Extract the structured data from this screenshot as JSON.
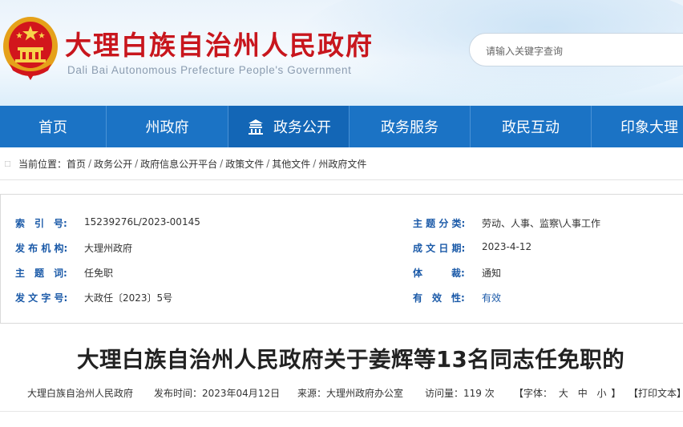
{
  "header": {
    "title": "大理白族自治州人民政府",
    "subtitle": "Dali Bai Autonomous Prefecture People's Government",
    "search_placeholder": "请输入关键字查询"
  },
  "nav": {
    "items": [
      {
        "label": "首页"
      },
      {
        "label": "州政府"
      },
      {
        "label": "政务公开"
      },
      {
        "label": "政务服务"
      },
      {
        "label": "政民互动"
      },
      {
        "label": "印象大理"
      }
    ],
    "active": "政务公开"
  },
  "breadcrumb": {
    "prefix": "当前位置：",
    "items": [
      "首页",
      "政务公开",
      "政府信息公开平台",
      "政策文件",
      "其他文件",
      "州政府文件"
    ],
    "separator": "/"
  },
  "info": {
    "index": {
      "label": "索　引　号:",
      "value": "15239276L/2023-00145"
    },
    "category": {
      "label": "主 题 分 类:",
      "value": "劳动、人事、监察\\人事工作"
    },
    "publisher": {
      "label": "发 布 机 构:",
      "value": "大理州政府"
    },
    "date": {
      "label": "成 文 日 期:",
      "value": "2023-4-12"
    },
    "keywords": {
      "label": "主　题　词:",
      "value": "任免职"
    },
    "genre": {
      "label": "体　　　裁:",
      "value": "通知"
    },
    "docno": {
      "label": "发 文 字 号:",
      "value": "大政任〔2023〕5号"
    },
    "validity": {
      "label": "有　效　性:",
      "value": "有效"
    }
  },
  "article": {
    "title": "大理白族自治州人民政府关于姜辉等13名同志任免职的",
    "source_org": "大理白族自治州人民政府",
    "publish_time": "发布时间：2023年04月12日",
    "origin": "来源：大理州政府办公室",
    "visits": "访问量：119 次",
    "font_label": "【字体：",
    "font_large": "大",
    "font_medium": "中",
    "font_small": "小",
    "font_close": "】",
    "print_label": "【打印文本】"
  },
  "colors": {
    "brand_red": "#c8161d",
    "nav_blue": "#1b73c5",
    "label_blue": "#1b5aa8"
  }
}
